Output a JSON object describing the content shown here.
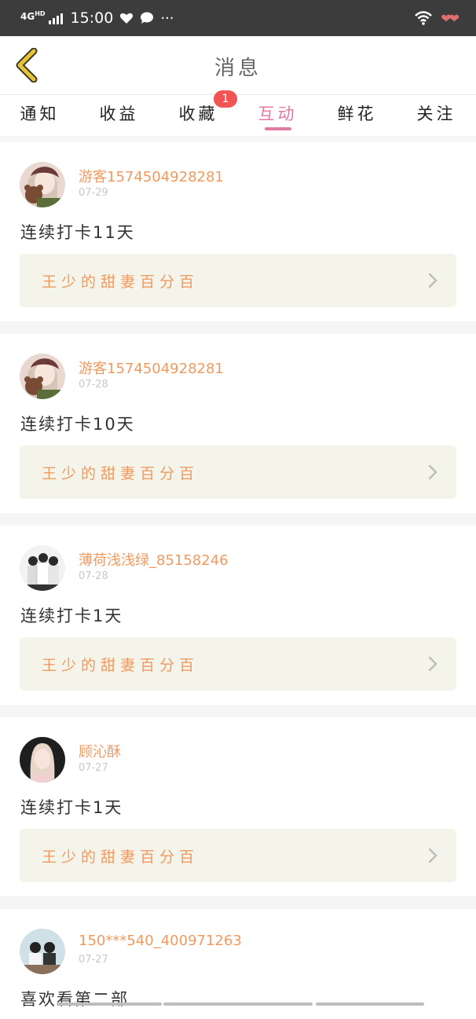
{
  "status_bar": {
    "network": "4G",
    "network_sup": "HD",
    "time": "15:00",
    "more": "···"
  },
  "header": {
    "title": "消息"
  },
  "tabs": [
    {
      "label": "通知",
      "active": false
    },
    {
      "label": "收益",
      "active": false
    },
    {
      "label": "收藏",
      "active": false,
      "badge": "1"
    },
    {
      "label": "互动",
      "active": true
    },
    {
      "label": "鲜花",
      "active": false
    },
    {
      "label": "关注",
      "active": false
    }
  ],
  "feed": {
    "items": [
      {
        "user": "游客1574504928281",
        "date": "07-29",
        "message": "连续打卡11天",
        "book": "王少的甜妻百分百",
        "avatar": "anime-girl-bear"
      },
      {
        "user": "游客1574504928281",
        "date": "07-28",
        "message": "连续打卡10天",
        "book": "王少的甜妻百分百",
        "avatar": "anime-girl-bear"
      },
      {
        "user": "薄荷浅浅绿_85158246",
        "date": "07-28",
        "message": "连续打卡1天",
        "book": "王少的甜妻百分百",
        "avatar": "group-photo"
      },
      {
        "user": "顾沁酥",
        "date": "07-27",
        "message": "连续打卡1天",
        "book": "王少的甜妻百分百",
        "avatar": "girl-portrait"
      },
      {
        "user": "150***540_400971263",
        "date": "07-27",
        "message": "喜欢看第二部",
        "avatar": "couple-photo"
      }
    ]
  },
  "colors": {
    "accent": "#e07aa3",
    "username": "#f09a60",
    "badge": "#f25353",
    "back_arrow": "#e8c33a",
    "card_link_bg": "#f4f4eb"
  }
}
